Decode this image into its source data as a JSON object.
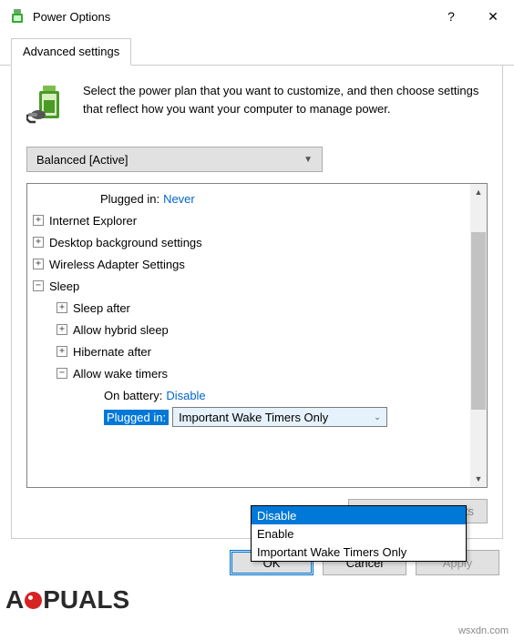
{
  "titlebar": {
    "title": "Power Options",
    "help": "?",
    "close": "✕"
  },
  "tabs": {
    "advanced": "Advanced settings"
  },
  "intro": "Select the power plan that you want to customize, and then choose settings that reflect how you want your computer to manage power.",
  "plan_selector": {
    "value": "Balanced [Active]"
  },
  "tree": {
    "row0": {
      "label": "Plugged in:",
      "value": "Never"
    },
    "ie": "Internet Explorer",
    "dbs": "Desktop background settings",
    "was": "Wireless Adapter Settings",
    "sleep": {
      "label": "Sleep",
      "after": "Sleep after",
      "hybrid": "Allow hybrid sleep",
      "hibernate": "Hibernate after",
      "wake": {
        "label": "Allow wake timers",
        "onbatt": {
          "label": "On battery:",
          "value": "Disable"
        },
        "plugged": {
          "label": "Plugged in:",
          "value": "Important Wake Timers Only"
        }
      }
    }
  },
  "dropdown": {
    "opt1": "Disable",
    "opt2": "Enable",
    "opt3": "Important Wake Timers Only"
  },
  "buttons": {
    "restore": "Restore plan defaults",
    "ok": "OK",
    "cancel": "Cancel",
    "apply": "Apply"
  },
  "watermark": {
    "part1": "A",
    "part2": "PUALS"
  },
  "source": "wsxdn.com"
}
